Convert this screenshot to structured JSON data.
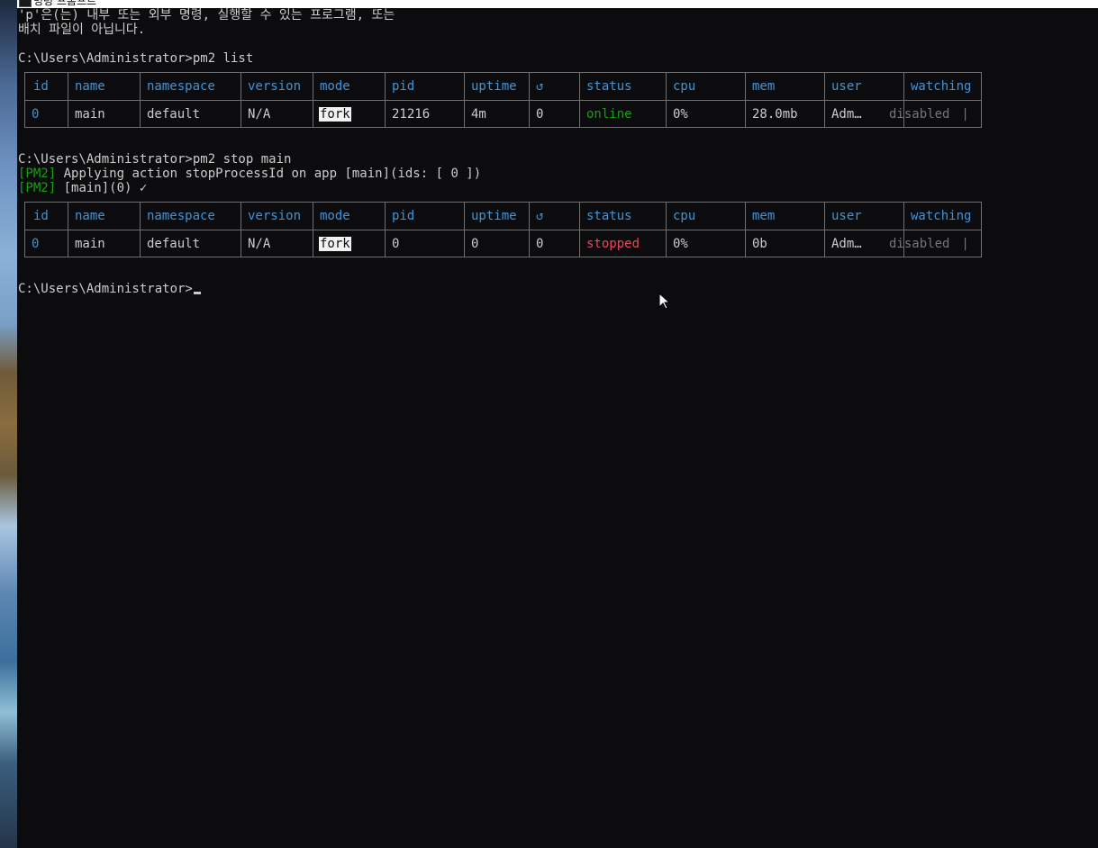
{
  "window": {
    "title": "명령 프롬프트"
  },
  "console": {
    "error_line1": "'p'은(는) 내부 또는 외부 명령, 실행할 수 있는 프로그램, 또는",
    "error_line2": "배치 파일이 아닙니다.",
    "prompt1": "C:\\Users\\Administrator>pm2 list",
    "prompt2": "C:\\Users\\Administrator>pm2 stop main",
    "pm2_tag": "[PM2]",
    "pm2_msg1": " Applying action stopProcessId on app [main](ids: [ 0 ])",
    "pm2_msg2": " [main](0) ✓",
    "prompt3": "C:\\Users\\Administrator>"
  },
  "table_headers": [
    "id",
    "name",
    "namespace",
    "version",
    "mode",
    "pid",
    "uptime",
    "↺",
    "status",
    "cpu",
    "mem",
    "user",
    "watching"
  ],
  "list_row": {
    "id": "0",
    "name": "main",
    "namespace": "default",
    "version": "N/A",
    "mode": "fork",
    "pid": "21216",
    "uptime": "4m",
    "restarts": "0",
    "status": "online",
    "cpu": "0%",
    "mem": "28.0mb",
    "user": "Adm…",
    "watching": "disabled",
    "end": " |"
  },
  "stop_row": {
    "id": "0",
    "name": "main",
    "namespace": "default",
    "version": "N/A",
    "mode": "fork",
    "pid": "0",
    "uptime": "0",
    "restarts": "0",
    "status": "stopped",
    "cpu": "0%",
    "mem": "0b",
    "user": "Adm…",
    "watching": "disabled",
    "end": " |"
  },
  "colors": {
    "background": "#0c0c0e",
    "text": "#cccccc",
    "header": "#3a96dd",
    "online": "#13a10e",
    "stopped": "#e74856",
    "muted": "#767676",
    "pm2_tag": "#13a10e"
  },
  "icons": {
    "cursor": "mouse-pointer-icon",
    "window": "cmd-window-icon"
  }
}
